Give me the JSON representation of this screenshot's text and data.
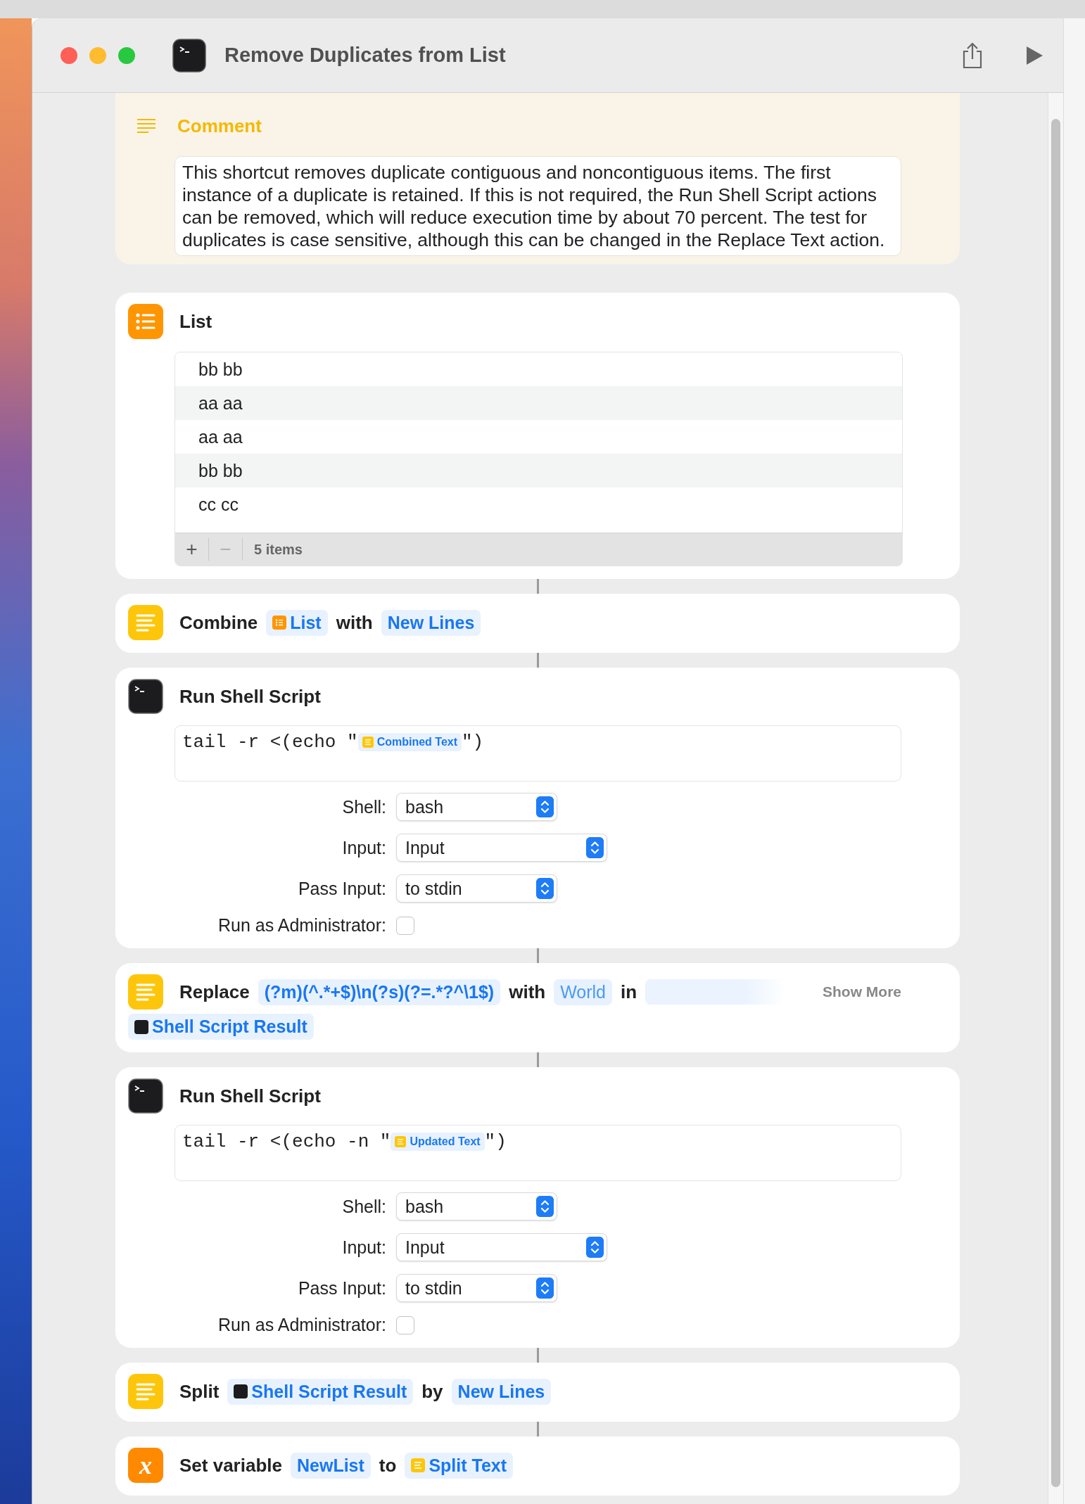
{
  "window": {
    "title": "Remove Duplicates from List"
  },
  "actions": [
    {
      "kind": "comment",
      "title": "Comment",
      "text": "This shortcut removes duplicate contiguous and noncontiguous items. The first instance of a duplicate is retained. If this is not required, the Run Shell Script actions can be removed, which will reduce execution time by about 70 percent. The test for duplicates is case sensitive, although this can be changed in the Replace Text action."
    },
    {
      "kind": "list",
      "title": "List",
      "items": [
        "bb bb",
        "aa aa",
        "aa aa",
        "bb bb",
        "cc cc"
      ],
      "add_label": "+",
      "remove_label": "−",
      "remove_disabled": true,
      "count": "5 items"
    },
    {
      "kind": "text-action",
      "parts": [
        {
          "kind": "word",
          "text": "Combine"
        },
        {
          "kind": "list-token",
          "text": "List"
        },
        {
          "kind": "word",
          "text": "with"
        },
        {
          "kind": "token",
          "text": "New Lines"
        }
      ]
    },
    {
      "kind": "shell",
      "title": "Run Shell Script",
      "script": [
        {
          "kind": "code",
          "text": "tail -r <(echo \""
        },
        {
          "kind": "text-token",
          "text": "Combined Text"
        },
        {
          "kind": "code",
          "text": "\")"
        }
      ],
      "fields": [
        {
          "kind": "popup",
          "label": "Shell:",
          "value": "bash"
        },
        {
          "kind": "popup",
          "label": "Input:",
          "value": "Input"
        },
        {
          "kind": "popup",
          "label": "Pass Input:",
          "value": "to stdin"
        },
        {
          "kind": "checkbox",
          "label": "Run as Administrator:",
          "checked": false
        }
      ]
    },
    {
      "kind": "text-action",
      "parts": [
        {
          "kind": "word",
          "text": "Replace"
        },
        {
          "kind": "token",
          "text": "(?m)(^.*+$)\\n(?s)(?=.*?^\\1$)"
        },
        {
          "kind": "word",
          "text": "with"
        },
        {
          "kind": "placeholder",
          "text": "World"
        },
        {
          "kind": "word",
          "text": "in"
        },
        {
          "kind": "empty"
        },
        {
          "kind": "more",
          "text": "Show More"
        },
        {
          "kind": "result-token",
          "text": "Shell Script Result"
        }
      ]
    },
    {
      "kind": "shell",
      "title": "Run Shell Script",
      "script": [
        {
          "kind": "code",
          "text": "tail -r <(echo -n \""
        },
        {
          "kind": "text-token",
          "text": "Updated Text"
        },
        {
          "kind": "code",
          "text": "\")"
        }
      ],
      "fields": [
        {
          "kind": "popup",
          "label": "Shell:",
          "value": "bash"
        },
        {
          "kind": "popup",
          "label": "Input:",
          "value": "Input"
        },
        {
          "kind": "popup",
          "label": "Pass Input:",
          "value": "to stdin"
        },
        {
          "kind": "checkbox",
          "label": "Run as Administrator:",
          "checked": false
        }
      ]
    },
    {
      "kind": "text-action",
      "parts": [
        {
          "kind": "word",
          "text": "Split"
        },
        {
          "kind": "result-token",
          "text": "Shell Script Result"
        },
        {
          "kind": "word",
          "text": "by"
        },
        {
          "kind": "token",
          "text": "New Lines"
        }
      ]
    },
    {
      "kind": "variable-action",
      "icon_glyph": "x",
      "parts": [
        {
          "kind": "word",
          "text": "Set variable"
        },
        {
          "kind": "token",
          "text": "NewList"
        },
        {
          "kind": "word",
          "text": "to"
        },
        {
          "kind": "text-token",
          "text": "Split Text"
        }
      ]
    }
  ]
}
